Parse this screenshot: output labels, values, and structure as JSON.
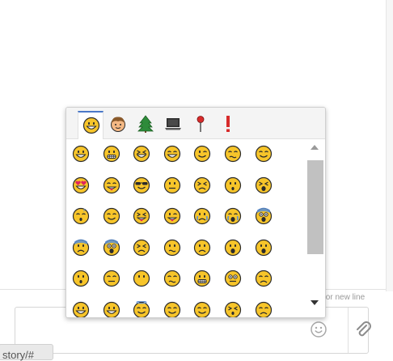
{
  "composer": {
    "hint_text": "for new line",
    "message_placeholder": ""
  },
  "url_tab": {
    "text": "story/#"
  },
  "emoji_picker": {
    "categories": [
      {
        "name": "smileys",
        "icon": "grinning-face-icon",
        "active": true
      },
      {
        "name": "people",
        "icon": "boy-face-icon",
        "active": false
      },
      {
        "name": "nature",
        "icon": "evergreen-tree-icon",
        "active": false
      },
      {
        "name": "objects",
        "icon": "laptop-icon",
        "active": false
      },
      {
        "name": "places",
        "icon": "round-pushpin-icon",
        "active": false
      },
      {
        "name": "symbols",
        "icon": "exclamation-icon",
        "active": false
      }
    ],
    "emojis": [
      "grinning",
      "grin",
      "laughing",
      "joy",
      "wink",
      "smirk",
      "blush",
      "heart-eyes",
      "yum",
      "sunglasses",
      "neutral",
      "persevere",
      "hushed",
      "tired",
      "sleeping",
      "relieved",
      "tongue-closed",
      "tongue-wink",
      "cry",
      "sob",
      "fearful",
      "cold-sweat",
      "scream",
      "angry",
      "confused",
      "frowning",
      "open-mouth",
      "anguished",
      "frowning-open",
      "expressionless",
      "no-mouth",
      "unamused",
      "grimacing",
      "flushed",
      "pensive",
      "sweat-smile",
      "sweat-smile",
      "innocent",
      "smile",
      "relieved",
      "dizzy",
      "sweat"
    ],
    "colors": {
      "face": "#f7c52a",
      "face_outline": "#2b2b2b",
      "accent": "#4a78c8"
    }
  }
}
